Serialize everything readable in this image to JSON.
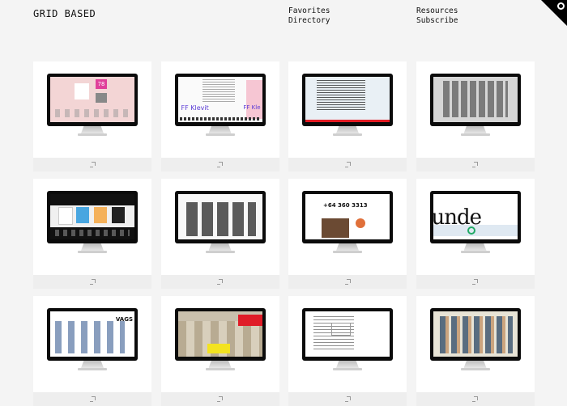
{
  "header": {
    "logo": "GRID BASED",
    "nav_col1": [
      "Favorites",
      "Directory"
    ],
    "nav_col2": [
      "Resources",
      "Subscribe"
    ]
  },
  "corner_icon": "search-icon",
  "screens": {
    "s1_label": "78",
    "s2_label_left": "FF Klevit",
    "s2_label_right": "FF Kle",
    "s7_label": "+64 360 3313",
    "s8_label": "unde",
    "s9_label": "VAGS"
  },
  "cards": [
    {
      "name": "card-1"
    },
    {
      "name": "card-2"
    },
    {
      "name": "card-3"
    },
    {
      "name": "card-4"
    },
    {
      "name": "card-5"
    },
    {
      "name": "card-6"
    },
    {
      "name": "card-7"
    },
    {
      "name": "card-8"
    },
    {
      "name": "card-9"
    },
    {
      "name": "card-10"
    },
    {
      "name": "card-11"
    },
    {
      "name": "card-12"
    }
  ],
  "colors": {
    "background": "#f4f4f4",
    "card": "#ffffff",
    "card_footer": "#eeeeee",
    "accent_red": "#e31b23"
  }
}
